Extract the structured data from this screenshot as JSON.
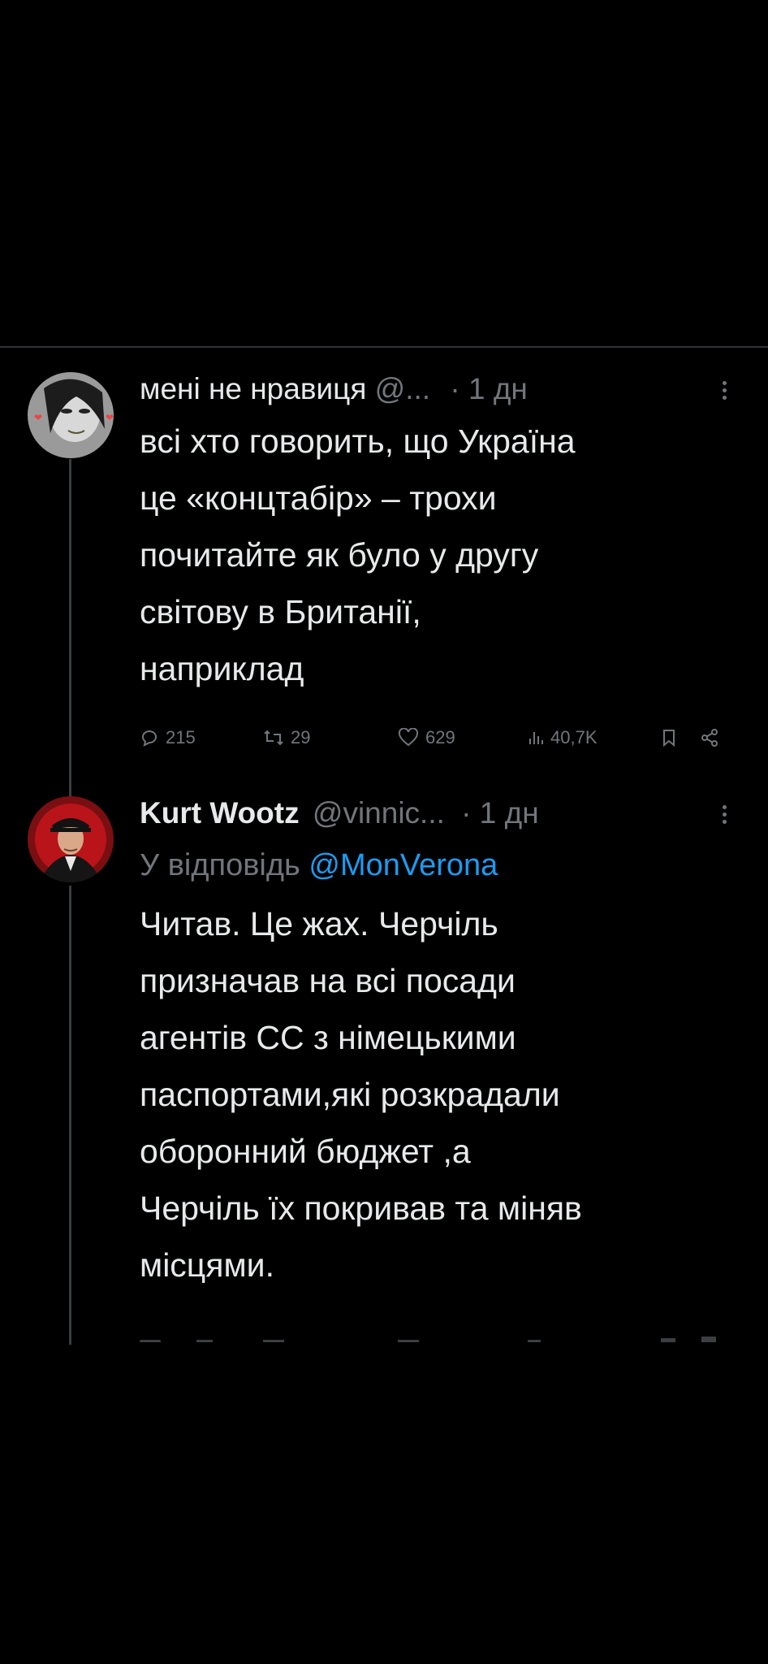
{
  "tweets": [
    {
      "display_name": "мені не нравиця",
      "handle": "@...",
      "time": "· 1 дн",
      "lines": [
        "всі хто говорить, що Україна",
        "це «концтабір» – трохи",
        "почитайте як було у другу",
        "світову в Британії,",
        "наприклад"
      ],
      "actions": {
        "replies": "215",
        "reposts": "29",
        "likes": "629",
        "views": "40,7K"
      }
    },
    {
      "display_name": "Kurt Wootz",
      "handle": "@vinnic...",
      "time": "· 1 дн",
      "reply_prefix": "У відповідь",
      "reply_mention": "@MonVerona",
      "lines": [
        "Читав. Це жах. Черчіль",
        "призначав на всі посади",
        "агентів СС з німецькими",
        "паспортами,які розкрадали",
        "оборонний бюджет ,а",
        "Черчіль їх покривав та міняв",
        "місцями."
      ]
    }
  ],
  "icons": {
    "reply": "reply-icon",
    "repost": "repost-icon",
    "like": "heart-icon",
    "views": "views-icon",
    "bookmark": "bookmark-icon",
    "share": "share-icon",
    "more": "more-dots-icon"
  },
  "colors": {
    "background": "#000000",
    "text": "#e7e9ea",
    "muted": "#71767b",
    "link": "#1d9bf0"
  }
}
